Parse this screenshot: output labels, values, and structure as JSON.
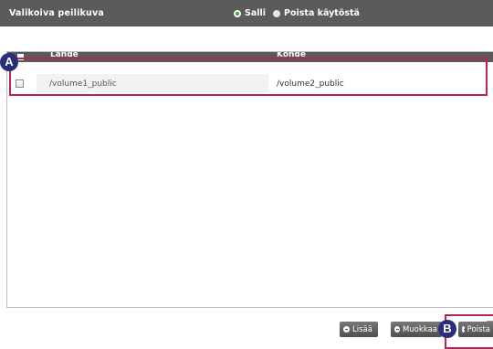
{
  "header": {
    "title": "Valikoiva peilikuva",
    "options": {
      "allow": "Salli",
      "disable": "Poista käytöstä"
    },
    "selected": "allow"
  },
  "table": {
    "columns": {
      "source": "Lähde",
      "target": "Kohde"
    },
    "rows": [
      {
        "source": "/volume1_public",
        "target": "/volume2_public",
        "checked": false
      }
    ]
  },
  "buttons": {
    "add": "Lisää",
    "edit": "Muokkaa",
    "delete": "Poista"
  },
  "callouts": {
    "a": "A",
    "b": "B"
  },
  "colors": {
    "header_bg": "#5b5b5b",
    "callout": "#b0255a",
    "badge": "#2a2d7a",
    "radio_on": "#3aa23a"
  }
}
